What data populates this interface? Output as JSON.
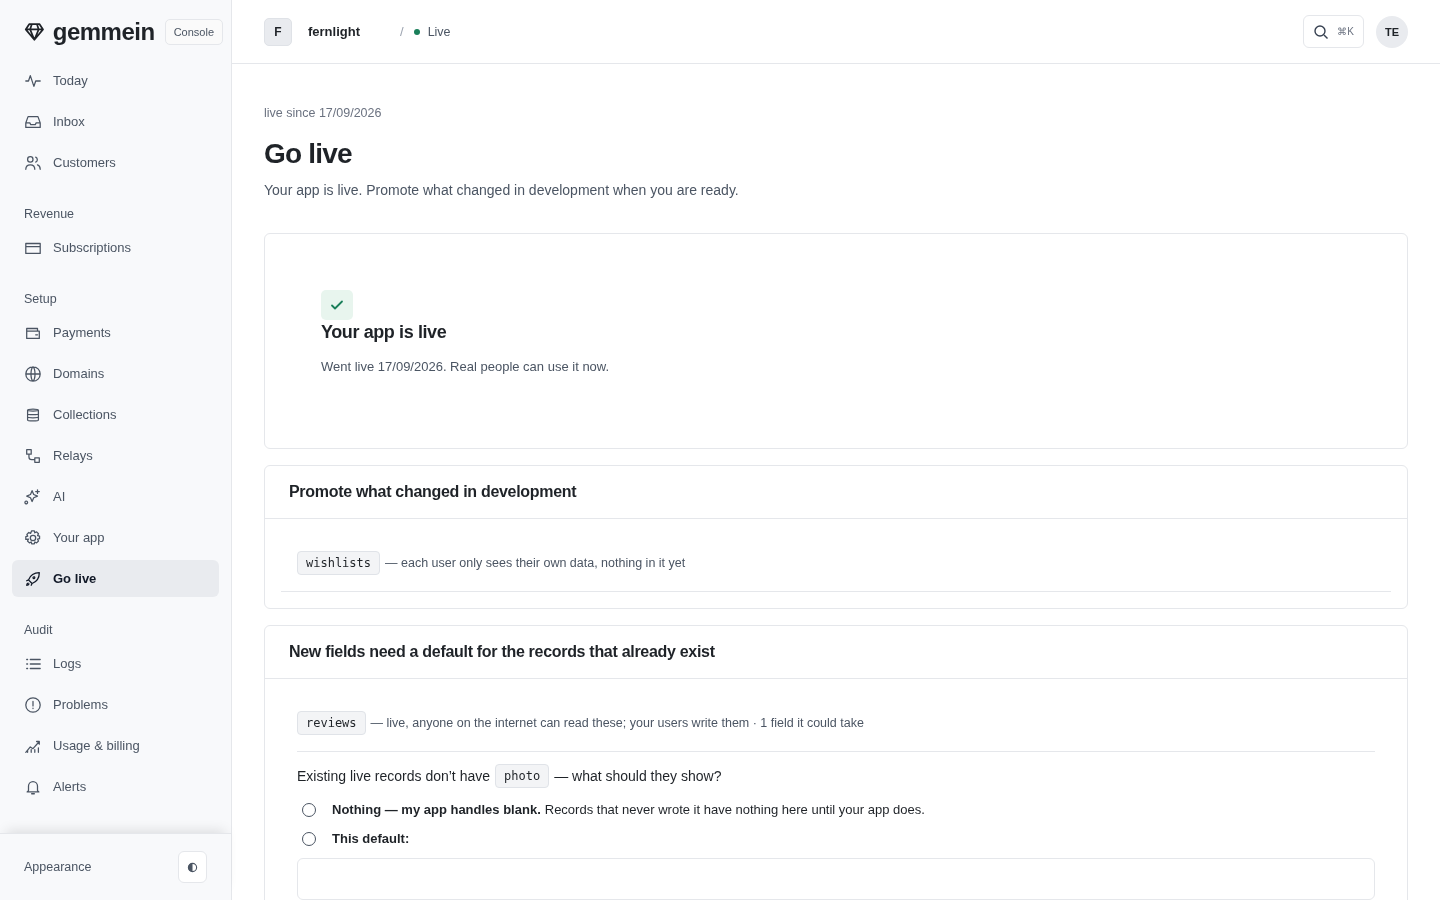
{
  "brand": {
    "name": "gemmein",
    "badge": "Console"
  },
  "sidebar": {
    "groups": [
      {
        "items": [
          {
            "label": "Today",
            "selected": false
          },
          {
            "label": "Inbox",
            "selected": false
          },
          {
            "label": "Customers",
            "selected": false
          }
        ]
      },
      {
        "heading": "Revenue",
        "items": [
          {
            "label": "Subscriptions",
            "selected": false
          }
        ]
      },
      {
        "heading": "Setup",
        "items": [
          {
            "label": "Payments",
            "selected": false
          },
          {
            "label": "Domains",
            "selected": false
          },
          {
            "label": "Collections",
            "selected": false
          },
          {
            "label": "Relays",
            "selected": false
          },
          {
            "label": "AI",
            "selected": false
          },
          {
            "label": "Your app",
            "selected": false
          },
          {
            "label": "Go live",
            "selected": true
          }
        ]
      },
      {
        "heading": "Audit",
        "items": [
          {
            "label": "Logs",
            "selected": false
          },
          {
            "label": "Problems",
            "selected": false
          },
          {
            "label": "Usage & billing",
            "selected": false
          },
          {
            "label": "Alerts",
            "selected": false
          }
        ]
      }
    ],
    "footer": {
      "label": "Appearance"
    }
  },
  "topbar": {
    "project_initial": "F",
    "project": "fernlight",
    "separator": "/",
    "status": "Live",
    "search_shortcut": "⌘K",
    "avatar": "TE"
  },
  "page": {
    "eyebrow": "live since 17/09/2026",
    "title": "Go live",
    "subtitle": "Your app is live. Promote what changed in development when you are ready."
  },
  "live_card": {
    "title": "Your app is live",
    "text": "Went live 17/09/2026. Real people can use it now."
  },
  "promote": {
    "title": "Promote what changed in development",
    "rows": [
      {
        "code": "wishlists",
        "text": "— each user only sees their own data, nothing in it yet"
      }
    ]
  },
  "defaults": {
    "title": "New fields need a default for the records that already exist",
    "collection": {
      "code": "reviews",
      "text": "— live, anyone on the internet can read these; your users write them · 1 field it could take"
    },
    "question": {
      "before": "Existing live records don’t have",
      "field": "photo",
      "after": "— what should they show?"
    },
    "options": [
      {
        "label": "Nothing — my app handles blank.",
        "detail": "Records that never wrote it have nothing here until your app does.",
        "selected": false
      },
      {
        "label": "This default:",
        "selected": false
      }
    ]
  }
}
